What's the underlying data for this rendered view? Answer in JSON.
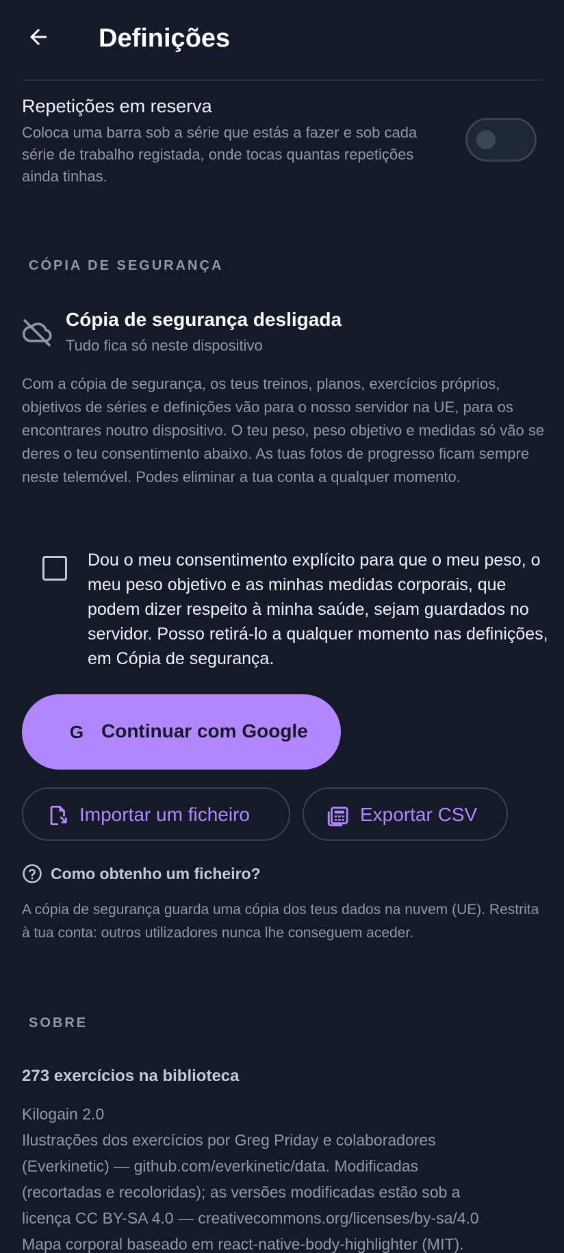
{
  "header": {
    "title": "Definições",
    "back_icon": "arrow-left-icon"
  },
  "reps_in_reserve": {
    "title": "Repetições em reserva",
    "description": "Coloca uma barra sob a série que estás a fazer e sob cada série de trabalho registada, onde tocas quantas repetições ainda tinhas.",
    "enabled": false
  },
  "backup_section": {
    "header": "CÓPIA DE SEGURANÇA",
    "status_icon": "cloud-off-icon",
    "status_title": "Cópia de segurança desligada",
    "status_subtitle": "Tudo fica só neste dispositivo",
    "description": "Com a cópia de segurança, os teus treinos, planos, exercícios próprios, objetivos de séries e definições vão para o nosso servidor na UE, para os encontrares noutro dispositivo. O teu peso, peso objetivo e medidas só vão se deres o teu consentimento abaixo. As tuas fotos de progresso ficam sempre neste telemóvel. Podes eliminar a tua conta a qualquer momento.",
    "consent_checked": false,
    "consent_text": "Dou o meu consentimento explícito para que o meu peso, o meu peso objetivo e as minhas medidas corporais, que podem dizer respeito à minha saúde, sejam guardados no servidor. Posso retirá-lo a qualquer momento nas definições, em Cópia de segurança.",
    "google_button": {
      "icon_letter": "G",
      "label": "Continuar com Google"
    },
    "import_button": {
      "icon": "file-import-icon",
      "label": "Importar um ficheiro"
    },
    "export_button": {
      "icon": "calculator-table-icon",
      "label": "Exportar CSV"
    },
    "help_link": {
      "icon": "help-circle-icon",
      "label": "Como obtenho um ficheiro?"
    },
    "cloud_note": "A cópia de segurança guarda uma cópia dos teus dados na nuvem (UE). Restrita à tua conta: outros utilizadores nunca lhe conseguem aceder."
  },
  "about_section": {
    "header": "SOBRE",
    "exercise_count": "273 exercícios na biblioteca",
    "lines": [
      "Kilogain 2.0",
      "Ilustrações dos exercícios por Greg Priday e colaboradores",
      "(Everkinetic) — github.com/everkinetic/data. Modificadas",
      "(recortadas e recoloridas); as versões modificadas estão sob a",
      "licença CC BY-SA 4.0 — creativecommons.org/licenses/by-sa/4.0",
      "Mapa corporal baseado em react-native-body-highlighter (MIT)."
    ]
  },
  "colors": {
    "background": "#151a29",
    "accent": "#b388ff",
    "text_primary": "#ffffff",
    "text_secondary": "#8f98aa",
    "divider": "#2a3142"
  }
}
